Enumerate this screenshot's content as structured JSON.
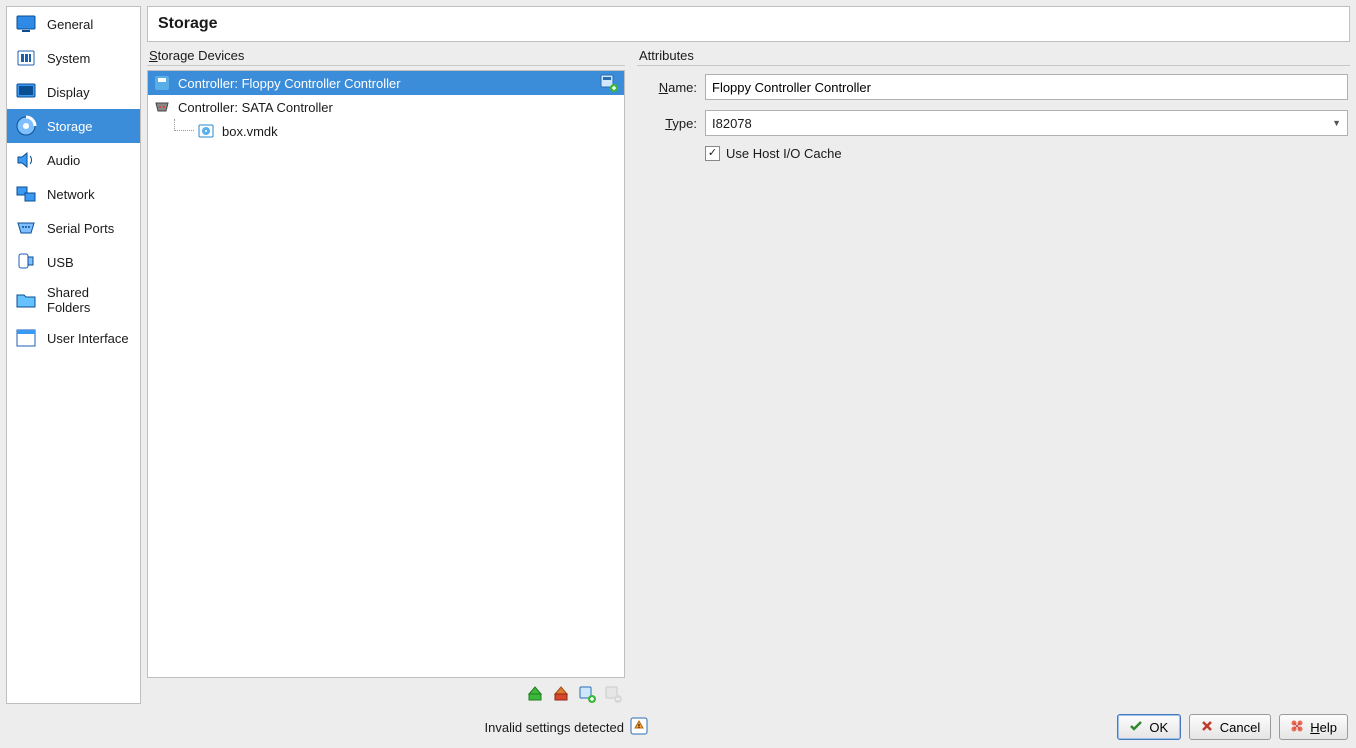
{
  "sidebar": {
    "items": [
      {
        "label": "General"
      },
      {
        "label": "System"
      },
      {
        "label": "Display"
      },
      {
        "label": "Storage"
      },
      {
        "label": "Audio"
      },
      {
        "label": "Network"
      },
      {
        "label": "Serial Ports"
      },
      {
        "label": "USB"
      },
      {
        "label": "Shared Folders"
      },
      {
        "label": "User Interface"
      }
    ],
    "selected_index": 3
  },
  "page": {
    "title": "Storage"
  },
  "storage_devices": {
    "group_label_pre": "S",
    "group_label_rest": "torage Devices",
    "tree": [
      {
        "label": "Controller: Floppy Controller Controller",
        "selected": true,
        "has_add": true
      },
      {
        "label": "Controller: SATA Controller"
      },
      {
        "label": "box.vmdk",
        "indent": 1
      }
    ]
  },
  "attributes": {
    "group_label": "Attributes",
    "name_label_pre": "N",
    "name_label_rest": "ame:",
    "name_value": "Floppy Controller Controller",
    "type_label_pre": "T",
    "type_label_rest": "ype:",
    "type_value": "I82078",
    "cache_checked": true,
    "cache_label": "Use Host I/O Cache"
  },
  "status": {
    "message": "Invalid settings detected"
  },
  "buttons": {
    "ok": "OK",
    "cancel": "Cancel",
    "help_pre": "H",
    "help_rest": "elp"
  }
}
